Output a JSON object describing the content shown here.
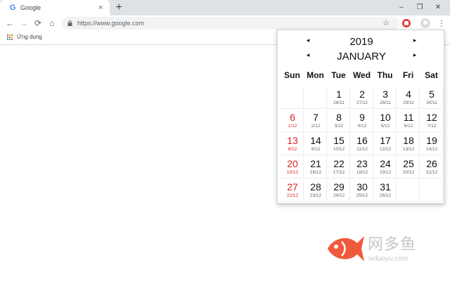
{
  "browser": {
    "tab": {
      "title": "Google",
      "favicon": "G",
      "close_glyph": "×"
    },
    "new_tab_glyph": "+",
    "window_controls": {
      "minimize": "–",
      "maximize": "❐",
      "close": "✕"
    },
    "nav": {
      "back": "←",
      "forward": "→",
      "reload": "⟳",
      "home": "⌂"
    },
    "url": "https://www.google.com",
    "star_glyph": "☆",
    "menu_glyph": "⋮",
    "icons": [
      "google-favicon-icon",
      "close-icon",
      "plus-icon",
      "back-arrow-icon",
      "forward-arrow-icon",
      "reload-icon",
      "home-icon",
      "lock-icon",
      "star-icon",
      "calendar-extension-icon",
      "profile-avatar-icon",
      "kebab-menu-icon",
      "apps-grid-icon"
    ],
    "colors": {
      "tabstrip": "#dee1e6",
      "omnibox": "#f1f3f4",
      "extension": "#e53935"
    }
  },
  "bookmarks": {
    "apps_label": "Ứng dụng"
  },
  "calendar": {
    "year": "2019",
    "month": "JANUARY",
    "prev_glyph": "◂",
    "next_glyph": "▸",
    "weekdays": [
      "Sun",
      "Mon",
      "Tue",
      "Wed",
      "Thu",
      "Fri",
      "Sat"
    ],
    "weeks": [
      [
        null,
        null,
        {
          "day": "1",
          "lunar": "26/11"
        },
        {
          "day": "2",
          "lunar": "27/11"
        },
        {
          "day": "3",
          "lunar": "28/11"
        },
        {
          "day": "4",
          "lunar": "29/11"
        },
        {
          "day": "5",
          "lunar": "30/11"
        }
      ],
      [
        {
          "day": "6",
          "lunar": "1/12"
        },
        {
          "day": "7",
          "lunar": "2/12"
        },
        {
          "day": "8",
          "lunar": "3/12"
        },
        {
          "day": "9",
          "lunar": "4/12"
        },
        {
          "day": "10",
          "lunar": "5/12"
        },
        {
          "day": "11",
          "lunar": "6/12"
        },
        {
          "day": "12",
          "lunar": "7/12"
        }
      ],
      [
        {
          "day": "13",
          "lunar": "8/12"
        },
        {
          "day": "14",
          "lunar": "9/12"
        },
        {
          "day": "15",
          "lunar": "10/12"
        },
        {
          "day": "16",
          "lunar": "11/12"
        },
        {
          "day": "17",
          "lunar": "12/12"
        },
        {
          "day": "18",
          "lunar": "13/12"
        },
        {
          "day": "19",
          "lunar": "14/12"
        }
      ],
      [
        {
          "day": "20",
          "lunar": "15/12"
        },
        {
          "day": "21",
          "lunar": "16/12"
        },
        {
          "day": "22",
          "lunar": "17/12"
        },
        {
          "day": "23",
          "lunar": "18/12"
        },
        {
          "day": "24",
          "lunar": "19/12"
        },
        {
          "day": "25",
          "lunar": "20/12"
        },
        {
          "day": "26",
          "lunar": "21/12"
        }
      ],
      [
        {
          "day": "27",
          "lunar": "22/12"
        },
        {
          "day": "28",
          "lunar": "23/12"
        },
        {
          "day": "29",
          "lunar": "24/12"
        },
        {
          "day": "30",
          "lunar": "25/12"
        },
        {
          "day": "31",
          "lunar": "26/12"
        },
        null,
        null
      ]
    ],
    "colors": {
      "sunday": "#e02020",
      "text": "#111111",
      "lunar": "#666666"
    }
  },
  "watermark": {
    "text": "网多鱼",
    "url": "wduoyu.com",
    "logo_color": "#f05a3c"
  }
}
